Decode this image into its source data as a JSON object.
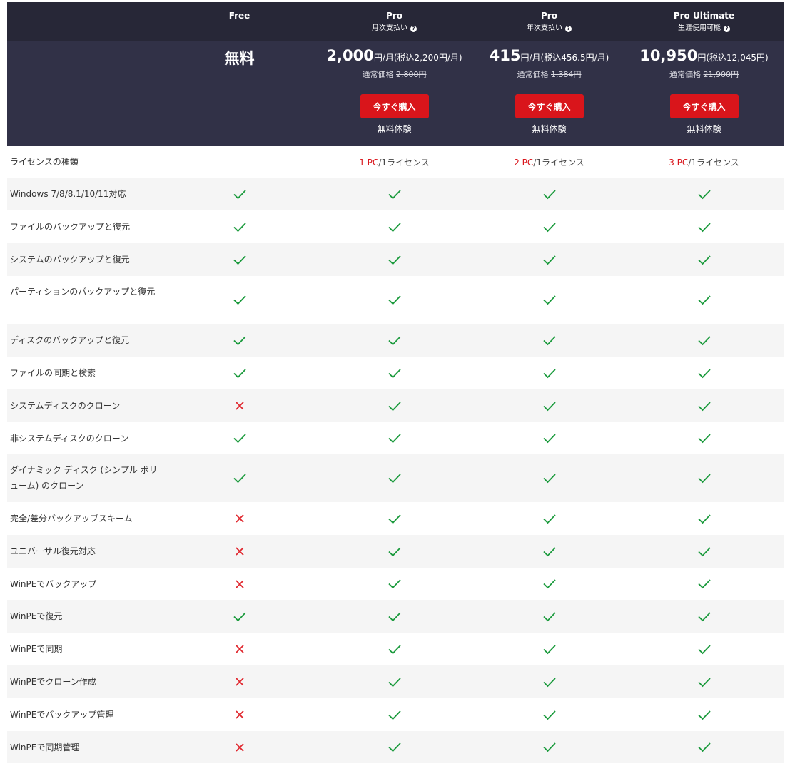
{
  "columns": [
    {
      "name": "Free",
      "sub": "",
      "help": false
    },
    {
      "name": "Pro",
      "sub": "月次支払い",
      "help": true
    },
    {
      "name": "Pro",
      "sub": "年次支払い",
      "help": true
    },
    {
      "name": "Pro Ultimate",
      "sub": "生涯使用可能",
      "help": true
    }
  ],
  "free_price": "無料",
  "prices": [
    {
      "amount": "2,000",
      "unit": "円/月(税込2,200円/月)",
      "regular_label": "通常価格",
      "regular_value": "2,800円"
    },
    {
      "amount": "415",
      "unit": "円/月(税込456.5円/月)",
      "regular_label": "通常価格",
      "regular_value": "1,384円"
    },
    {
      "amount": "10,950",
      "unit": "円(税込12,045円)",
      "regular_label": "通常価格",
      "regular_value": "21,900円"
    }
  ],
  "buy_label": "今すぐ購入",
  "trial_label": "無料体験",
  "license": {
    "label": "ライセンスの種類",
    "values": [
      {
        "count": "1 PC",
        "rest": "/1ライセンス"
      },
      {
        "count": "2 PC",
        "rest": "/1ライセンス"
      },
      {
        "count": "3 PC",
        "rest": "/1ライセンス"
      }
    ]
  },
  "colors": {
    "check": "#1a9a3c",
    "cross": "#e0262d",
    "accent": "#d9151b",
    "header_top": "#272737",
    "header_bottom": "#313147"
  },
  "features": [
    {
      "label": "Windows 7/8/8.1/10/11対応",
      "free": true
    },
    {
      "label": "ファイルのバックアップと復元",
      "free": true
    },
    {
      "label": "システムのバックアップと復元",
      "free": true
    },
    {
      "label": "パーティションのバックアップと復元",
      "free": true
    },
    {
      "label": "ディスクのバックアップと復元",
      "free": true
    },
    {
      "label": "ファイルの同期と検索",
      "free": true
    },
    {
      "label": "システムディスクのクローン",
      "free": false
    },
    {
      "label": "非システムディスクのクローン",
      "free": true
    },
    {
      "label": "ダイナミック ディスク (シンプル ボリューム) のクローン",
      "free": true
    },
    {
      "label": "完全/差分バックアップスキーム",
      "free": false
    },
    {
      "label": "ユニバーサル復元対応",
      "free": false
    },
    {
      "label": "WinPEでバックアップ",
      "free": false
    },
    {
      "label": "WinPEで復元",
      "free": true
    },
    {
      "label": "WinPEで同期",
      "free": false
    },
    {
      "label": "WinPEでクローン作成",
      "free": false
    },
    {
      "label": "WinPEでバックアップ管理",
      "free": false
    },
    {
      "label": "WinPEで同期管理",
      "free": false
    }
  ]
}
